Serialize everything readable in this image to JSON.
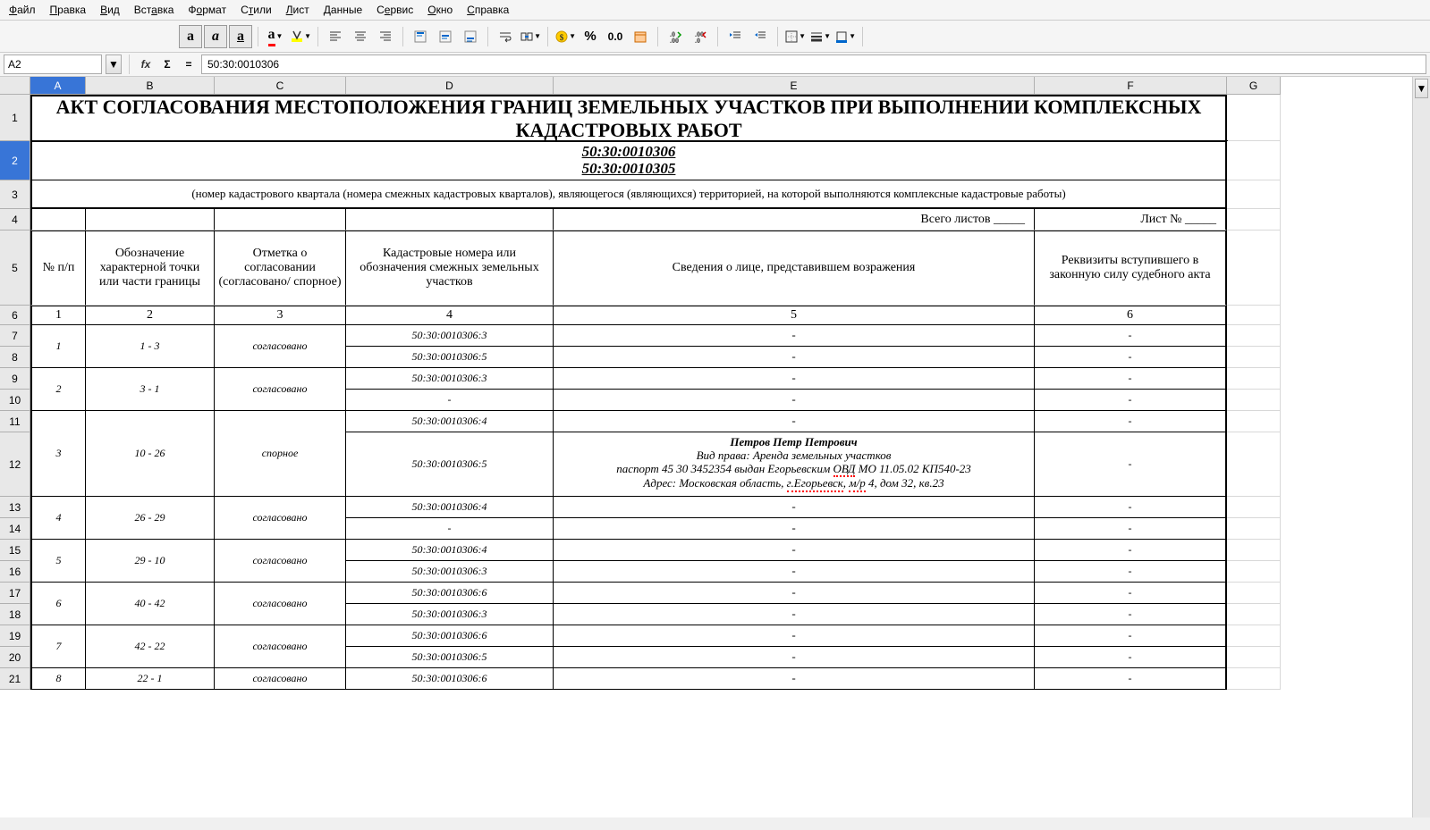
{
  "menu": [
    "Файл",
    "Правка",
    "Вид",
    "Вставка",
    "Формат",
    "Стили",
    "Лист",
    "Данные",
    "Сервис",
    "Окно",
    "Справка"
  ],
  "cellRef": "A2",
  "formula": "50:30:0010306",
  "cols": {
    "A": 62,
    "B": 144,
    "C": 147,
    "D": 232,
    "E": 538,
    "F": 215,
    "G": 60
  },
  "doc": {
    "title": "АКТ СОГЛАСОВАНИЯ МЕСТОПОЛОЖЕНИЯ ГРАНИЦ ЗЕМЕЛЬНЫХ УЧАСТКОВ ПРИ ВЫПОЛНЕНИИ КОМПЛЕКСНЫХ КАДАСТРОВЫХ РАБОТ",
    "cad1": "50:30:0010306",
    "cad2": "50:30:0010305",
    "note": "(номер кадастрового квартала (номера смежных кадастровых кварталов), являющегося (являющихся) территорией, на которой выполняются комплексные кадастровые работы)",
    "totalSheets": "Всего листов _____",
    "sheetNo": "Лист № _____",
    "h1": "№ п/п",
    "h2": "Обозначение характерной точки или части границы",
    "h3": "Отметка о согласовании (согласовано/ спорное)",
    "h4": "Кадастровые номера или обозначения смежных земельных участков",
    "h5": "Сведения о лице, представившем возражения",
    "h6": "Реквизиты вступившего в законную силу судебного акта",
    "n1": "1",
    "n2": "2",
    "n3": "3",
    "n4": "4",
    "n5": "5",
    "n6": "6",
    "rows": [
      {
        "n": "1",
        "pt": "1 - 3",
        "st": "согласовано",
        "cad": [
          "50:30:0010306:3",
          "50:30:0010306:5"
        ],
        "info": [
          "-",
          "-"
        ],
        "req": [
          "-",
          "-"
        ]
      },
      {
        "n": "2",
        "pt": "3 - 1",
        "st": "согласовано",
        "cad": [
          "50:30:0010306:3",
          "-"
        ],
        "info": [
          "-",
          "-"
        ],
        "req": [
          "-",
          "-"
        ]
      },
      {
        "n": "3",
        "pt": "10 - 26",
        "st": "спорное",
        "cad": [
          "50:30:0010306:4",
          "50:30:0010306:5"
        ],
        "info": [
          "-",
          "MULTI"
        ],
        "req": [
          "-",
          "-"
        ]
      },
      {
        "n": "4",
        "pt": "26 - 29",
        "st": "согласовано",
        "cad": [
          "50:30:0010306:4",
          "-"
        ],
        "info": [
          "-",
          "-"
        ],
        "req": [
          "-",
          "-"
        ]
      },
      {
        "n": "5",
        "pt": "29 - 10",
        "st": "согласовано",
        "cad": [
          "50:30:0010306:4",
          "50:30:0010306:3"
        ],
        "info": [
          "-",
          "-"
        ],
        "req": [
          "-",
          "-"
        ]
      },
      {
        "n": "6",
        "pt": "40 - 42",
        "st": "согласовано",
        "cad": [
          "50:30:0010306:6",
          "50:30:0010306:3"
        ],
        "info": [
          "-",
          "-"
        ],
        "req": [
          "-",
          "-"
        ]
      },
      {
        "n": "7",
        "pt": "42 - 22",
        "st": "согласовано",
        "cad": [
          "50:30:0010306:6",
          "50:30:0010306:5"
        ],
        "info": [
          "-",
          "-"
        ],
        "req": [
          "-",
          "-"
        ]
      },
      {
        "n": "8",
        "pt": "22 - 1",
        "st": "согласовано",
        "cad": [
          "50:30:0010306:6"
        ],
        "info": [
          "-"
        ],
        "req": [
          "-"
        ]
      }
    ],
    "petrov": {
      "l1": "Петров Петр Петрович",
      "l2": "Вид права: Аренда земельных участков",
      "l3a": "паспорт 45 30 3452354 выдан Егорьевским ",
      "l3b": "ОВД",
      "l3c": " МО 11.05.02 КП540-23",
      "l4a": "Адрес: Московская область, ",
      "l4b": "г.Егорьевск",
      "l4c": ", ",
      "l4d": "м/р",
      "l4e": " 4, дом 32, кв.23"
    }
  }
}
